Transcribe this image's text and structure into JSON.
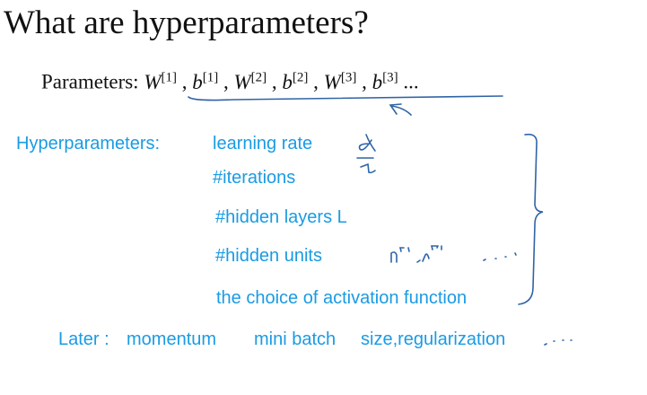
{
  "title": "What are hyperparameters?",
  "parameters": {
    "label": "Parameters:",
    "items": [
      {
        "sym": "W",
        "sup": "[1]"
      },
      {
        "sym": "b",
        "sup": "[1]"
      },
      {
        "sym": "W",
        "sup": "[2]"
      },
      {
        "sym": "b",
        "sup": "[2]"
      },
      {
        "sym": "W",
        "sup": "[3]"
      },
      {
        "sym": "b",
        "sup": "[3]"
      }
    ],
    "ellipsis": "..."
  },
  "hyperparameters": {
    "label": "Hyperparameters:",
    "items": [
      "learning rate",
      "#iterations",
      "#hidden layers  L",
      "#hidden units",
      "the choice of activation function"
    ]
  },
  "later": {
    "label": "Later :",
    "items": [
      "momentum",
      "mini batch",
      "size,regularization"
    ]
  },
  "colors": {
    "text_blue": "#1a9be3",
    "ink": "#2f64a6"
  }
}
